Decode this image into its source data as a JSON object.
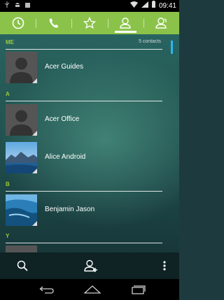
{
  "status_bar": {
    "time": "09:41",
    "left_icons": [
      "usb-icon",
      "android-icon",
      "square-notification-icon"
    ],
    "right_icons": [
      "wifi-icon",
      "signal-icon",
      "battery-icon"
    ]
  },
  "tabs": [
    {
      "name": "tab-recent",
      "icon": "clock-icon",
      "active": false
    },
    {
      "name": "tab-phone",
      "icon": "phone-icon",
      "active": false
    },
    {
      "name": "tab-favorites",
      "icon": "star-icon",
      "active": false
    },
    {
      "name": "tab-contacts",
      "icon": "person-icon",
      "active": true
    },
    {
      "name": "tab-groups",
      "icon": "group-icon",
      "active": false
    }
  ],
  "colors": {
    "tab_bar": "#8bc34a",
    "section_letter": "#9ccc3a",
    "scroll_indicator": "#29b6f6"
  },
  "me_section": {
    "header": "ME",
    "count_label": "5 contacts"
  },
  "sections": {
    "a": "A",
    "b": "B",
    "y": "Y"
  },
  "contacts": {
    "acer_guides": {
      "name": "Acer Guides",
      "avatar": "default-avatar"
    },
    "acer_office": {
      "name": "Acer Office",
      "avatar": "default-avatar"
    },
    "alice_android": {
      "name": "Alice Android",
      "avatar": "photo-avatar"
    },
    "benjamin_jason": {
      "name": "Benjamin Jason",
      "avatar": "photo-avatar"
    }
  },
  "actions": [
    "search-icon",
    "add-contact-icon",
    "overflow-menu-icon"
  ],
  "nav": [
    "back-icon",
    "home-icon",
    "recent-apps-icon"
  ]
}
